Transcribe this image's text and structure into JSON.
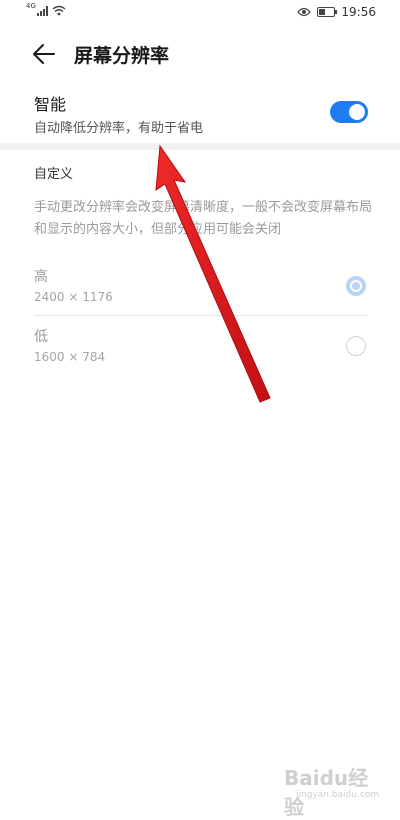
{
  "status_bar": {
    "signal_tag": "4G",
    "time": "19:56",
    "icons": [
      "signal-icon",
      "wifi-icon",
      "eye-icon",
      "battery-icon"
    ]
  },
  "header": {
    "title": "屏幕分辨率"
  },
  "smart": {
    "title": "智能",
    "description": "自动降低分辨率，有助于省电",
    "enabled": true
  },
  "custom": {
    "header": "自定义",
    "description": "手动更改分辨率会改变屏幕清晰度，一般不会改变屏幕布局和显示的内容大小，但部分应用可能会关闭"
  },
  "options": [
    {
      "label": "高",
      "resolution": "2400 × 1176",
      "selected": true
    },
    {
      "label": "低",
      "resolution": "1600 × 784",
      "selected": false
    }
  ],
  "annotation": {
    "type": "red-arrow",
    "points_to": "smart-toggle-area"
  },
  "watermark": {
    "main": "Baidu经验",
    "sub": "jingyan.baidu.com"
  },
  "colors": {
    "accent": "#1d7cf2",
    "disabled_radio": "#b8d5f8",
    "arrow": "#e0161c"
  }
}
